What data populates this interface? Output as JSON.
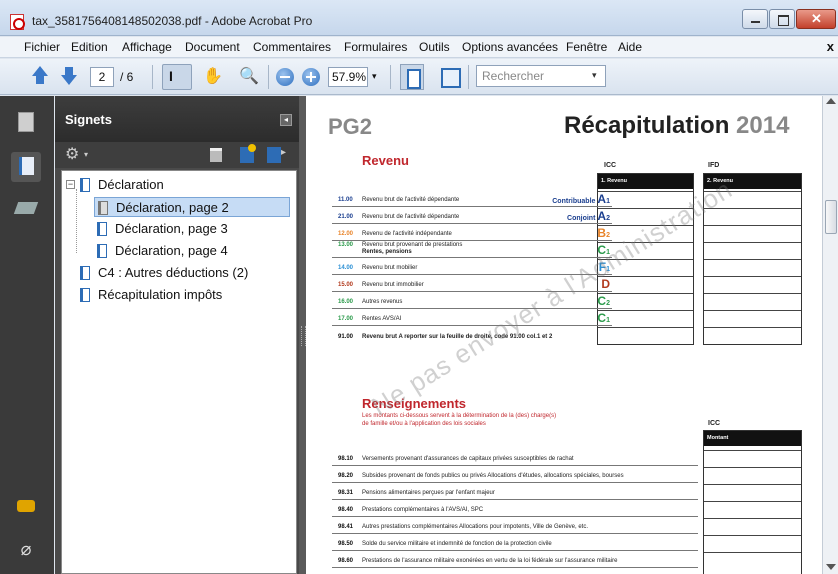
{
  "window": {
    "title": "tax_3581756408148502038.pdf - Adobe Acrobat Pro"
  },
  "menu": {
    "items": [
      "Fichier",
      "Edition",
      "Affichage",
      "Document",
      "Commentaires",
      "Formulaires",
      "Outils",
      "Options avancées",
      "Fenêtre",
      "Aide"
    ],
    "close_glyph": "x"
  },
  "toolbar": {
    "page_current": "2",
    "page_total": "/ 6",
    "zoom": "57.9%",
    "zoom_dropdown": "▾",
    "search_placeholder": "Rechercher",
    "search_dropdown": "▾",
    "select_tool_glyph": "I",
    "hand_glyph": "✋",
    "zoom_glyph": "🔍"
  },
  "bookmarks": {
    "title": "Signets",
    "collapse_glyph": "◂",
    "gear_glyph": "⚙",
    "gear_drop": "▾",
    "items": [
      {
        "label": "Déclaration",
        "toggle": "−"
      },
      {
        "label": "Déclaration, page 2"
      },
      {
        "label": "Déclaration, page 3"
      },
      {
        "label": "Déclaration, page 4"
      },
      {
        "label": "C4 : Autres déductions (2)"
      },
      {
        "label": "Récapitulation impôts"
      }
    ]
  },
  "document": {
    "page_id": "PG2",
    "title": "Récapitulation",
    "year": "2014",
    "revenu": {
      "heading": "Revenu",
      "icc_label": "ICC",
      "ifd_label": "IFD",
      "icc_bar": "1. Revenu",
      "ifd_bar": "2. Revenu",
      "rows": [
        {
          "code": "11.00",
          "label": "Revenu brut de l'activité dépendante",
          "pre": "Contribuable",
          "tag": "A",
          "sub": "1",
          "color": "#1b3f8f"
        },
        {
          "code": "21.00",
          "label": "Revenu brut de l'activité dépendante",
          "pre": "Conjoint",
          "tag": "A",
          "sub": "2",
          "color": "#1b3f8f"
        },
        {
          "code": "12.00",
          "label": "Revenu de l'activité indépendante",
          "tag": "B",
          "sub": "2",
          "color": "#e8842a"
        },
        {
          "code": "13.00",
          "label": "Revenu brut provenant de prestations",
          "label2": "Rentes, pensions",
          "tag": "C",
          "sub": "1",
          "color": "#2a9a4a"
        },
        {
          "code": "14.00",
          "label": "Revenu brut mobilier",
          "tag": "F",
          "sub": "1",
          "color": "#2a8fd4"
        },
        {
          "code": "15.00",
          "label": "Revenu brut immobilier",
          "tag": "D",
          "sub": "",
          "color": "#b23a1e"
        },
        {
          "code": "16.00",
          "label": "Autres revenus",
          "tag": "C",
          "sub": "2",
          "color": "#2a9a4a"
        },
        {
          "code": "17.00",
          "label": "Rentes AVS/AI",
          "tag": "C",
          "sub": "1",
          "color": "#2a9a4a"
        },
        {
          "code": "91.00",
          "label": "Revenu brut  A reporter sur la  feuille de droite, code 91.00 col.1 et 2",
          "tag": "",
          "sub": "",
          "color": "#111"
        }
      ]
    },
    "renseignements": {
      "heading": "Renseignements",
      "subtitle": "Les montants ci-dessous servent à la détermination de la (des) charge(s) de famille et/ou à l'application des lois sociales",
      "icc_label": "ICC",
      "bar": "Montant",
      "rows": [
        {
          "code": "98.10",
          "label": "Versements provenant d'assurances de capitaux privées susceptibles de rachat"
        },
        {
          "code": "98.20",
          "label": "Subsides provenant de fonds publics ou privés Allocations d'études, allocations spéciales, bourses"
        },
        {
          "code": "98.31",
          "label": "Pensions alimentaires perçues par l'enfant majeur"
        },
        {
          "code": "98.40",
          "label": "Prestations complémentaires à l'AVS/AI, SPC"
        },
        {
          "code": "98.41",
          "label": "Autres prestations complémentaires Allocations pour impotents, Ville de Genève, etc."
        },
        {
          "code": "98.50",
          "label": "Solde du service militaire et indemnité de fonction de la protection civile"
        },
        {
          "code": "98.60",
          "label": "Prestations de l'assurance militaire exonérées en vertu de la loi fédérale sur l'assurance militaire"
        }
      ]
    },
    "watermark": "Ne pas envoyer à l'Administration"
  },
  "colors": {
    "accent_blue": "#2d6cb5",
    "section_red": "#c0272d",
    "panel_dark": "#3a3a3a"
  }
}
